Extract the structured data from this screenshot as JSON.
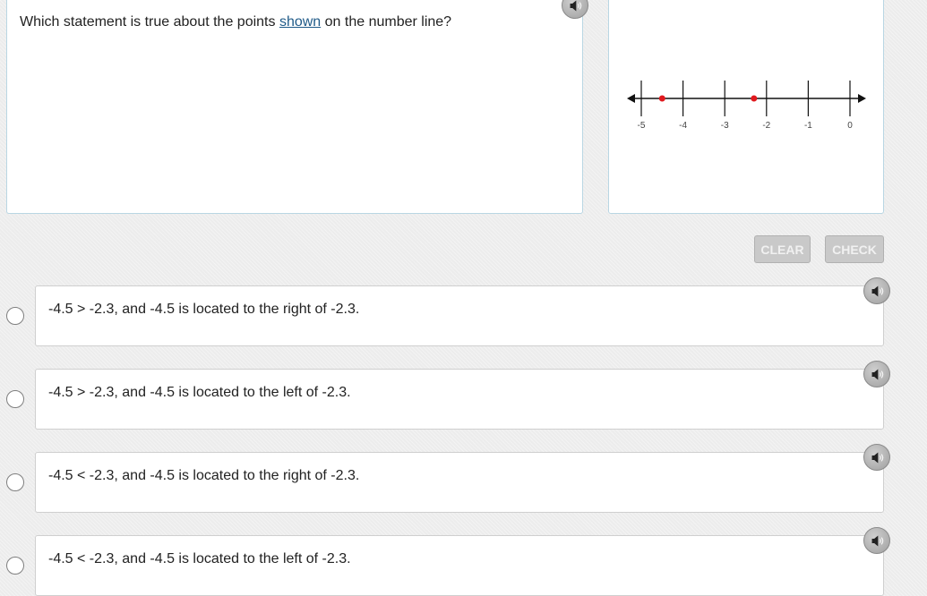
{
  "question": {
    "text_before": "Which statement is true about the points ",
    "link_text": "shown",
    "text_after": " on the number line?"
  },
  "number_line": {
    "tick_labels": [
      "-5",
      "-4",
      "-3",
      "-2",
      "-1",
      "0"
    ],
    "points": [
      -4.5,
      -2.3
    ],
    "point_color": "#e0191e"
  },
  "controls": {
    "clear_label": "CLEAR",
    "check_label": "CHECK"
  },
  "options": [
    {
      "text": "-4.5 > -2.3, and -4.5 is located to the right of -2.3."
    },
    {
      "text": "-4.5 > -2.3, and -4.5 is located to the left of -2.3."
    },
    {
      "text": "-4.5 < -2.3, and -4.5 is located to the right of -2.3."
    },
    {
      "text": "-4.5 < -2.3, and -4.5 is located to the left of -2.3."
    }
  ],
  "icons": {
    "audio": "speaker-icon"
  }
}
